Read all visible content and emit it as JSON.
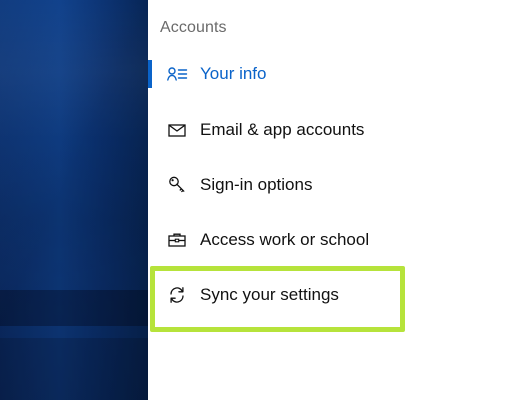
{
  "settings": {
    "section_title": "Accounts",
    "items": [
      {
        "label": "Your info",
        "icon": "person-list-icon",
        "selected": true
      },
      {
        "label": "Email & app accounts",
        "icon": "mail-icon",
        "selected": false
      },
      {
        "label": "Sign-in options",
        "icon": "key-icon",
        "selected": false
      },
      {
        "label": "Access work or school",
        "icon": "briefcase-icon",
        "selected": false
      },
      {
        "label": "Sync your settings",
        "icon": "sync-icon",
        "selected": false
      }
    ]
  },
  "colors": {
    "accent": "#0a63c9",
    "highlight": "#b6e33b",
    "section_title": "#6a6a6a",
    "text": "#111111"
  }
}
